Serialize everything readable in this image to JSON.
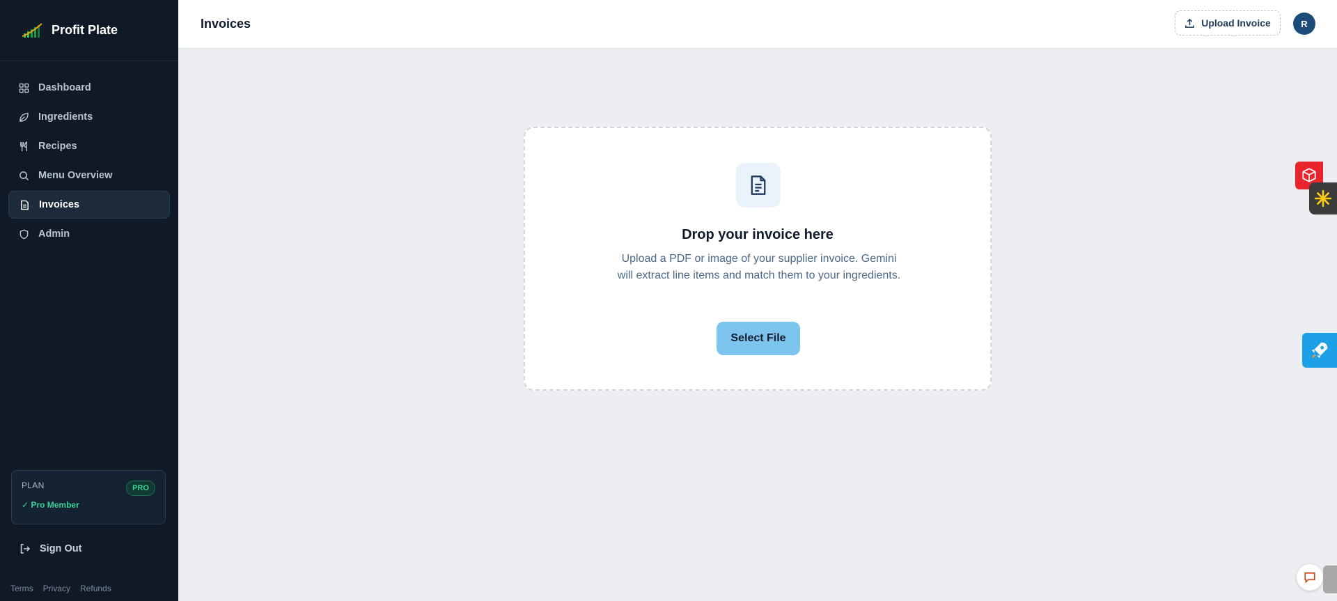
{
  "brand": {
    "name": "Profit Plate"
  },
  "sidebar": {
    "items": [
      {
        "label": "Dashboard",
        "icon": "grid-icon"
      },
      {
        "label": "Ingredients",
        "icon": "leaf-icon"
      },
      {
        "label": "Recipes",
        "icon": "utensils-icon"
      },
      {
        "label": "Menu Overview",
        "icon": "search-icon"
      },
      {
        "label": "Invoices",
        "icon": "document-icon",
        "active": true
      },
      {
        "label": "Admin",
        "icon": "shield-icon"
      }
    ],
    "plan": {
      "label": "PLAN",
      "badge": "PRO",
      "status": "✓ Pro Member"
    },
    "sign_out": "Sign Out",
    "footer_links": [
      "Terms",
      "Privacy",
      "Refunds"
    ]
  },
  "header": {
    "title": "Invoices",
    "upload_label": "Upload Invoice",
    "avatar_initial": "R"
  },
  "dropzone": {
    "title": "Drop your invoice here",
    "description": "Upload a PDF or image of your supplier invoice. Gemini will extract line items and match them to your ingredients.",
    "button": "Select File"
  },
  "colors": {
    "sidebar_bg": "#101a26",
    "accent_green": "#34d399",
    "select_button": "#7cc3ee",
    "avatar_bg": "#1e4c7a"
  }
}
